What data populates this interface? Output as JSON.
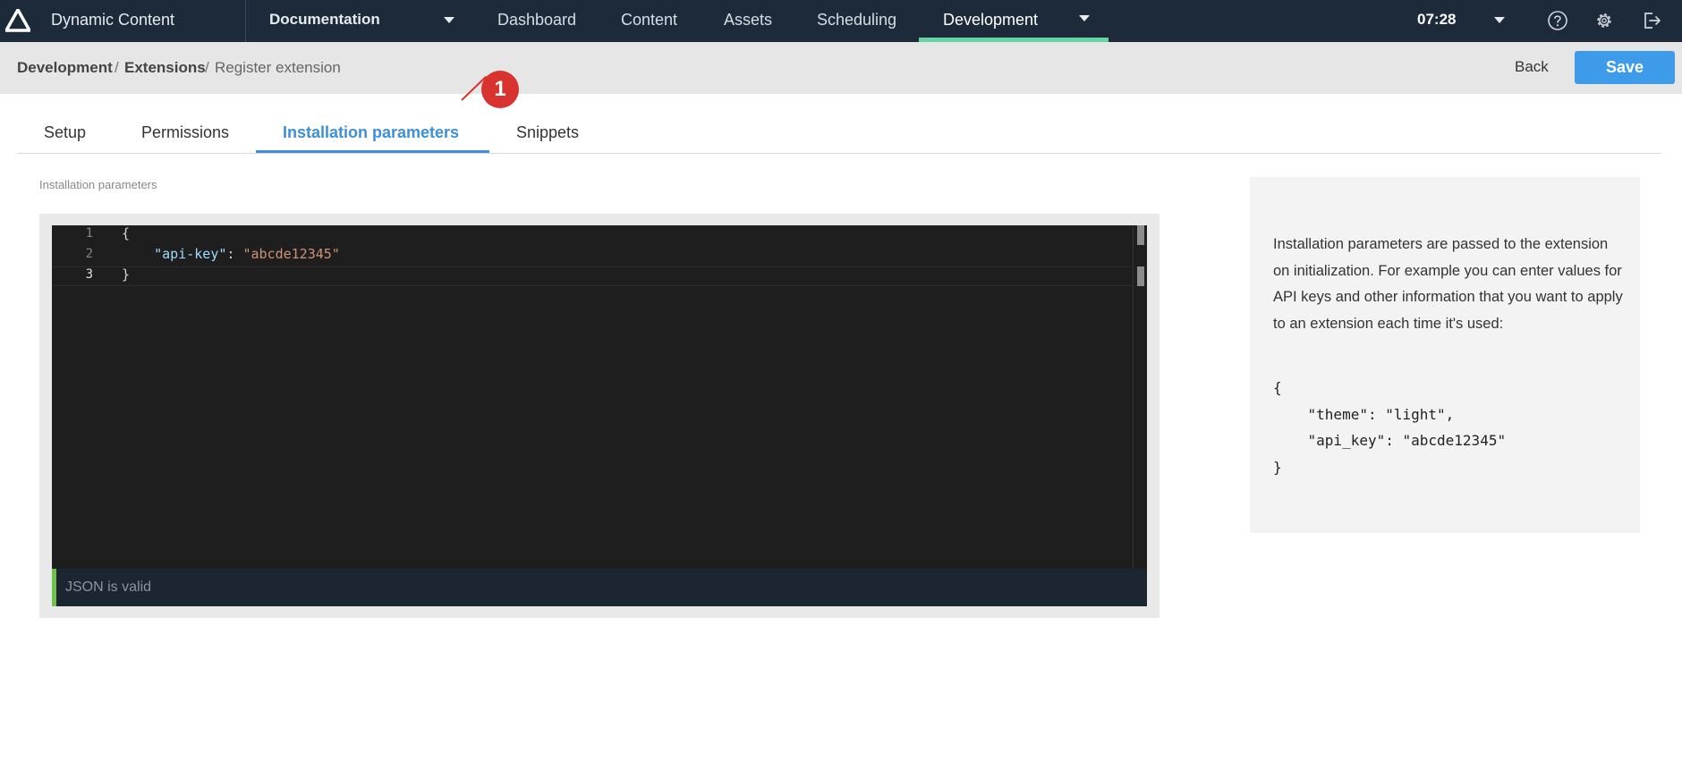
{
  "app": {
    "title": "Dynamic Content"
  },
  "hub": {
    "label": "Documentation"
  },
  "nav": {
    "items": [
      {
        "label": "Dashboard"
      },
      {
        "label": "Content"
      },
      {
        "label": "Assets"
      },
      {
        "label": "Scheduling"
      },
      {
        "label": "Development"
      }
    ],
    "active": "Development"
  },
  "header": {
    "time": "07:28",
    "icons": [
      "help-icon",
      "settings-gear-icon",
      "logout-icon"
    ]
  },
  "breadcrumb": {
    "items": [
      "Development",
      "Extensions",
      "Register extension"
    ],
    "separator": "/"
  },
  "actions": {
    "back_label": "Back",
    "save_label": "Save"
  },
  "tabs": {
    "items": [
      {
        "label": "Setup"
      },
      {
        "label": "Permissions"
      },
      {
        "label": "Installation parameters"
      },
      {
        "label": "Snippets"
      }
    ],
    "active": "Installation parameters"
  },
  "callout": {
    "number": "1"
  },
  "editor": {
    "field_label": "Installation parameters",
    "line_numbers": [
      "1",
      "2",
      "3"
    ],
    "current_line": "3",
    "lines": [
      {
        "text": "{"
      },
      {
        "indent": "    ",
        "key": "\"api-key\"",
        "colon": ": ",
        "value": "\"abcde12345\""
      },
      {
        "text": "}"
      }
    ],
    "status": "JSON is valid"
  },
  "help": {
    "text": "Installation parameters are passed to the extension on initialization. For example you can enter values for API keys and other information that you want to apply to an extension each time it's used:",
    "example_lines": [
      "{",
      "    \"theme\": \"light\",",
      "    \"api_key\": \"abcde12345\"",
      "}"
    ]
  },
  "colors": {
    "topbar": "#1c2a3a",
    "accent_blue": "#3d9be9",
    "active_nav_underline": "#65d4a1",
    "callout_red": "#d9332f",
    "valid_green": "#6cc24a"
  }
}
